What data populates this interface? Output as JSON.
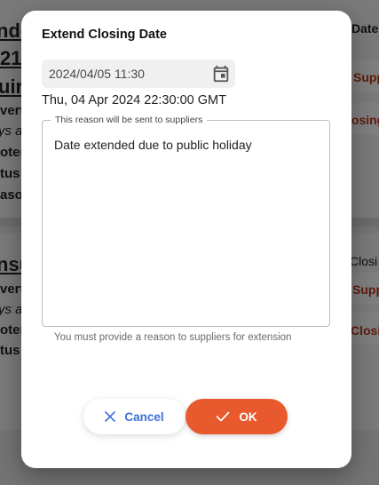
{
  "background": {
    "frag_1": "nde",
    "frag_2": "21:",
    "frag_3": "uir",
    "frag_4": "vert",
    "frag_5": "ys a",
    "frag_6": "oter",
    "frag_7": "tus",
    "frag_8": "asor",
    "frag_9": "nsu",
    "frag_10": "vert",
    "frag_11": "ys a",
    "frag_12": "oter",
    "frag_13": "tus",
    "right_1": "Date:",
    "right_2": "Supp",
    "right_3": "losing",
    "right_4": "Closi",
    "right_5": "Supp",
    "right_6": "Closi"
  },
  "dialog": {
    "title": "Extend Closing Date",
    "date_value": "2024/04/05 11:30",
    "date_display": "Thu, 04 Apr 2024 22:30:00 GMT",
    "reason_legend": "This reason will be sent to suppliers",
    "reason_text": "Date extended due to public holiday",
    "helper_text": "You must provide a reason to suppliers for extension",
    "cancel_label": "Cancel",
    "ok_label": "OK"
  },
  "colors": {
    "accent": "#e85a2e",
    "cancel_text": "#3a6fd8",
    "background_link": "#c0391b"
  },
  "icons": {
    "date_field": "calendar-icon",
    "cancel": "close-icon",
    "ok": "check-icon"
  }
}
